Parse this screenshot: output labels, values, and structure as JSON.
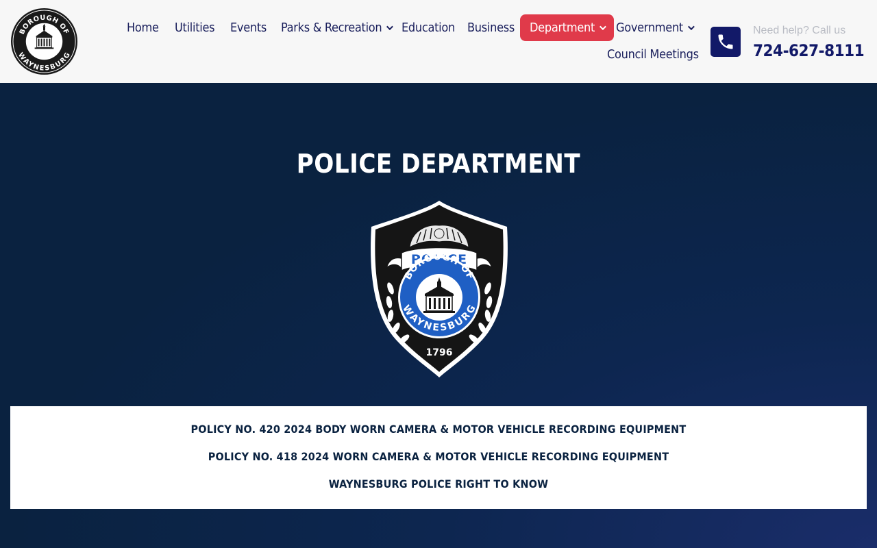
{
  "header": {
    "logo": {
      "text_top": "BOROUGH OF",
      "text_bottom": "WAYNESBURG"
    },
    "nav": [
      {
        "label": "Home"
      },
      {
        "label": "Utilities"
      },
      {
        "label": "Events"
      },
      {
        "label": "Parks & Recreation",
        "has_dropdown": true
      },
      {
        "label": "Education"
      },
      {
        "label": "Business"
      },
      {
        "label": "Department",
        "has_dropdown": true,
        "active": true
      },
      {
        "label": "Government",
        "has_dropdown": true
      },
      {
        "label": "Council Meetings"
      }
    ],
    "help_text": "Need help? Call us",
    "phone": "724-627-8111",
    "phone_icon": "phone-icon"
  },
  "hero": {
    "title": "POLICE DEPARTMENT",
    "badge": {
      "banner_text": "POLICE",
      "text_top": "BOROUGH OF",
      "text_bottom": "WAYNESBURG",
      "year": "1796"
    }
  },
  "documents": [
    {
      "label": "POLICY NO. 420 2024 BODY WORN CAMERA & MOTOR VEHICLE RECORDING EQUIPMENT"
    },
    {
      "label": "POLICY NO. 418 2024 WORN CAMERA & MOTOR VEHICLE RECORDING EQUIPMENT"
    },
    {
      "label": "WAYNESBURG POLICE RIGHT TO KNOW"
    }
  ],
  "colors": {
    "nav_text": "#1a1f5c",
    "active_nav": "#e03a4a",
    "hero_bg": "#0a2240",
    "phone_accent": "#121968",
    "badge_blue": "#1f5fc4"
  }
}
